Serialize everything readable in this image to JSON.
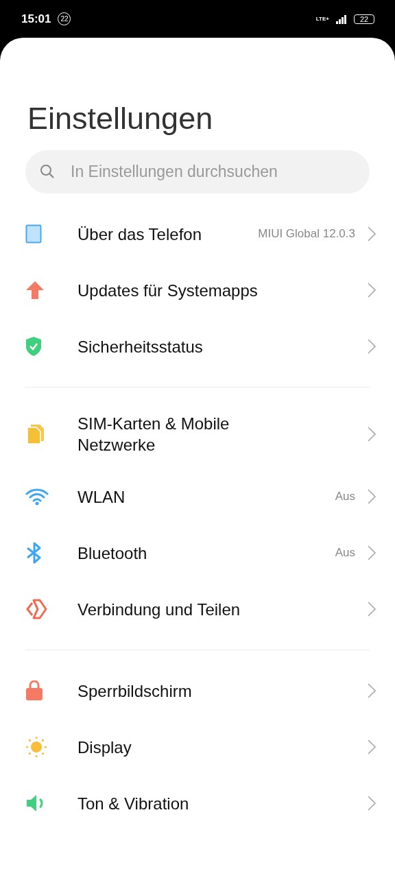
{
  "status_bar": {
    "time": "15:01",
    "notification_count": "22",
    "network": "LTE+",
    "battery": "22"
  },
  "title": "Einstellungen",
  "search": {
    "placeholder": "In Einstellungen durchsuchen"
  },
  "groups": [
    {
      "items": [
        {
          "kind": "tablet",
          "label": "Über das Telefon",
          "value": "MIUI Global 12.0.3"
        },
        {
          "kind": "arrow",
          "label": "Updates für Systemapps"
        },
        {
          "kind": "shield",
          "label": "Sicherheitsstatus"
        }
      ]
    },
    {
      "items": [
        {
          "kind": "sim",
          "label": "SIM-Karten & Mobile Netzwerke"
        },
        {
          "kind": "wifi",
          "label": "WLAN",
          "value": "Aus"
        },
        {
          "kind": "bluetooth",
          "label": "Bluetooth",
          "value": "Aus"
        },
        {
          "kind": "share",
          "label": "Verbindung und Teilen"
        }
      ]
    },
    {
      "items": [
        {
          "kind": "lock",
          "label": "Sperrbildschirm"
        },
        {
          "kind": "sun",
          "label": "Display"
        },
        {
          "kind": "speaker",
          "label": "Ton & Vibration"
        }
      ]
    }
  ]
}
